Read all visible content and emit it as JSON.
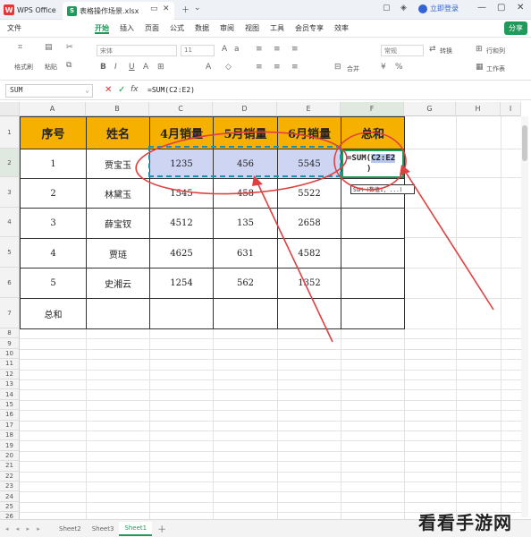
{
  "titlebar": {
    "app_name": "WPS Office",
    "logo_letter": "W",
    "file_logo_letter": "S",
    "file_tab_label": "表格操作场景.xlsx",
    "login_label": "立即登录",
    "share_label": "分享"
  },
  "menubar": {
    "items": [
      "文件",
      "开始",
      "插入",
      "页面",
      "公式",
      "数据",
      "审阅",
      "视图",
      "工具",
      "会员专享",
      "效率"
    ],
    "active": "开始"
  },
  "ribbon": {
    "format_painter": "格式刷",
    "paste": "粘贴",
    "font_name": "宋体",
    "font_size": "11",
    "merge": "合并",
    "number_format": "常规",
    "convert": "转换",
    "row_col": "行和列",
    "worksheet": "工作表"
  },
  "formula_bar": {
    "name_box": "SUM",
    "cancel_icon": "✕",
    "confirm_icon": "✓",
    "fx_label": "fx",
    "formula": "=SUM(C2:E2)"
  },
  "columns": [
    "A",
    "B",
    "C",
    "D",
    "E",
    "F",
    "G",
    "H",
    "I"
  ],
  "rows": [
    "1",
    "2",
    "3",
    "4",
    "5",
    "6",
    "7",
    "8",
    "9",
    "10",
    "11",
    "12",
    "13",
    "14",
    "15",
    "16",
    "17",
    "18",
    "19",
    "20",
    "21",
    "22",
    "23",
    "24",
    "25",
    "26"
  ],
  "table": {
    "headers": [
      "序号",
      "姓名",
      "4月销量",
      "5月销量",
      "6月销量",
      "总和"
    ],
    "rows": [
      [
        "1",
        "贾宝玉",
        "1235",
        "456",
        "5545",
        ""
      ],
      [
        "2",
        "林黛玉",
        "1545",
        "458",
        "5522",
        ""
      ],
      [
        "3",
        "薛宝钗",
        "4512",
        "135",
        "2658",
        ""
      ],
      [
        "4",
        "贾琏",
        "4625",
        "631",
        "4582",
        ""
      ],
      [
        "5",
        "史湘云",
        "1254",
        "562",
        "1352",
        ""
      ],
      [
        "总和",
        "",
        "",
        "",
        "",
        ""
      ]
    ]
  },
  "formula_cell": {
    "prefix": "=SUM(",
    "ref": "C2:E2",
    "suffix": ")"
  },
  "tooltip": "SUM (数值1, ...)",
  "sheets": [
    "Sheet2",
    "Sheet3",
    "Sheet1"
  ],
  "active_sheet": "Sheet1",
  "nav_arrows": "◂ ◂ ▸ ▸",
  "watermark": "看看手游网",
  "annotation_color": "#e04040",
  "header_fill": "#f6b000",
  "selection_fill": "#cdd5f3",
  "accent_color": "#1f9a5a"
}
